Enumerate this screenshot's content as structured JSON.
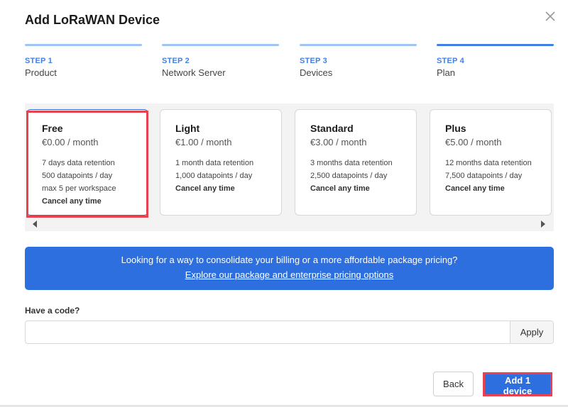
{
  "dialog": {
    "title": "Add LoRaWAN Device"
  },
  "steps": [
    {
      "number": "STEP 1",
      "name": "Product",
      "active": false
    },
    {
      "number": "STEP 2",
      "name": "Network Server",
      "active": false
    },
    {
      "number": "STEP 3",
      "name": "Devices",
      "active": false
    },
    {
      "number": "STEP 4",
      "name": "Plan",
      "active": true
    }
  ],
  "plans": [
    {
      "name": "Free",
      "price": "€0.00 / month",
      "features": [
        "7 days data retention",
        "500 datapoints / day",
        "max 5 per workspace",
        "Cancel any time"
      ],
      "selected": true
    },
    {
      "name": "Light",
      "price": "€1.00 / month",
      "features": [
        "1 month data retention",
        "1,000 datapoints / day",
        "Cancel any time"
      ],
      "selected": false
    },
    {
      "name": "Standard",
      "price": "€3.00 / month",
      "features": [
        "3 months data retention",
        "2,500 datapoints / day",
        "Cancel any time"
      ],
      "selected": false
    },
    {
      "name": "Plus",
      "price": "€5.00 / month",
      "features": [
        "12 months data retention",
        "7,500 datapoints / day",
        "Cancel any time"
      ],
      "selected": false
    }
  ],
  "banner": {
    "text": "Looking for a way to consolidate your billing or a more affordable package pricing?",
    "link": "Explore our package and enterprise pricing options"
  },
  "code": {
    "label": "Have a code?",
    "value": "",
    "placeholder": "",
    "apply_label": "Apply"
  },
  "footer": {
    "back_label": "Back",
    "add_label": "Add 1 device"
  },
  "colors": {
    "accent": "#2e6fe0",
    "highlight": "#e8424f"
  }
}
